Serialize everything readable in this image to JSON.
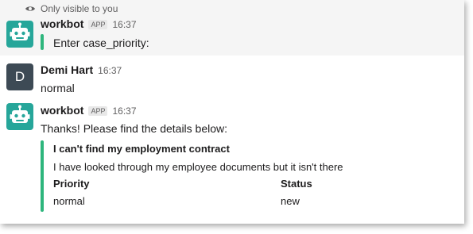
{
  "ephemeral_note": {
    "icon": "eye-icon",
    "text": "Only visible to you"
  },
  "messages": [
    {
      "author": "workbot",
      "badge": "APP",
      "time": "16:37",
      "text": "Enter case_priority:"
    },
    {
      "author": "Demi Hart",
      "initial": "D",
      "time": "16:37",
      "text": "normal"
    },
    {
      "author": "workbot",
      "badge": "APP",
      "time": "16:37",
      "text": "Thanks! Please find the details below:",
      "attachment": {
        "title": "I can't find my employment contract",
        "body": "I have looked through my employee documents but it isn't there",
        "fields": [
          {
            "label": "Priority",
            "value": "normal"
          },
          {
            "label": "Status",
            "value": "new"
          }
        ]
      }
    }
  ],
  "colors": {
    "accent_bar": "#2eb67d",
    "bot_avatar": "#26a69a",
    "user_avatar": "#3d4a55",
    "ephemeral_bg": "#f5f5f5"
  }
}
